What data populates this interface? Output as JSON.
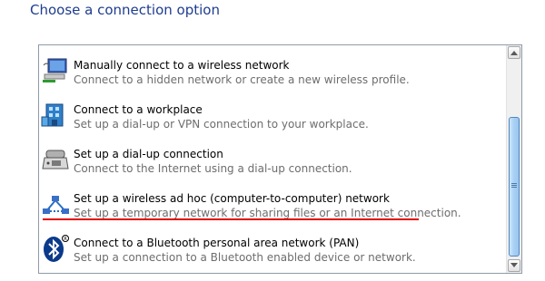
{
  "heading": "Choose a connection option",
  "options": [
    {
      "title": "Manually connect to a wireless network",
      "description": "Connect to a hidden network or create a new wireless profile.",
      "icon": "wireless-computer-icon"
    },
    {
      "title": "Connect to a workplace",
      "description": "Set up a dial-up or VPN connection to your workplace.",
      "icon": "workplace-building-icon"
    },
    {
      "title": "Set up a dial-up connection",
      "description": "Connect to the Internet using a dial-up connection.",
      "icon": "dialup-phone-icon"
    },
    {
      "title": "Set up a wireless ad hoc (computer-to-computer) network",
      "description": "Set up a temporary network for sharing files or an Internet connection.",
      "icon": "adhoc-network-icon"
    },
    {
      "title": "Connect to a Bluetooth personal area network (PAN)",
      "description": "Set up a connection to a Bluetooth enabled device or network.",
      "icon": "bluetooth-icon"
    }
  ],
  "colors": {
    "heading": "#1e3d8f",
    "annotation_underline": "#e00000",
    "description": "#6d6d6d"
  }
}
